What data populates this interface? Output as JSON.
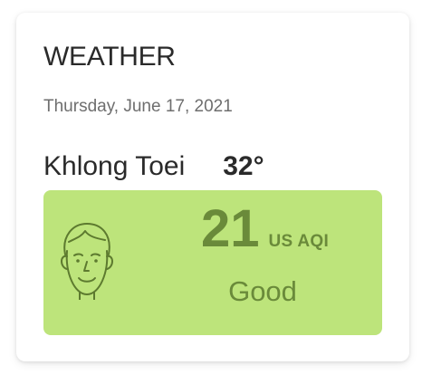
{
  "widget": {
    "title": "WEATHER",
    "date": "Thursday, June 17, 2021"
  },
  "location": {
    "city": "Khlong Toei",
    "temperature": "32°"
  },
  "aqi": {
    "value": "21",
    "unit": "US AQI",
    "status": "Good",
    "face_icon": "smiling-face-icon",
    "colors": {
      "background": "#bde47b",
      "text": "#6a8a3a"
    }
  }
}
